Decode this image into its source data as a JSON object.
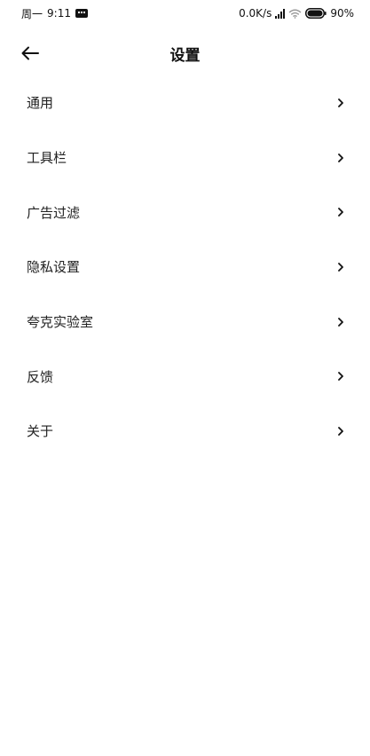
{
  "status_bar": {
    "day": "周一",
    "time": "9:11",
    "net_speed": "0.0K/s",
    "battery": "90%"
  },
  "header": {
    "title": "设置",
    "back_icon": "arrow-left-icon"
  },
  "settings": [
    {
      "label": "通用"
    },
    {
      "label": "工具栏"
    },
    {
      "label": "广告过滤"
    },
    {
      "label": "隐私设置"
    },
    {
      "label": "夸克实验室"
    },
    {
      "label": "反馈"
    },
    {
      "label": "关于"
    }
  ],
  "icons": {
    "chevron": "chevron-right-icon"
  },
  "colors": {
    "background": "#ffffff",
    "text": "#222222",
    "icon": "#111111"
  }
}
